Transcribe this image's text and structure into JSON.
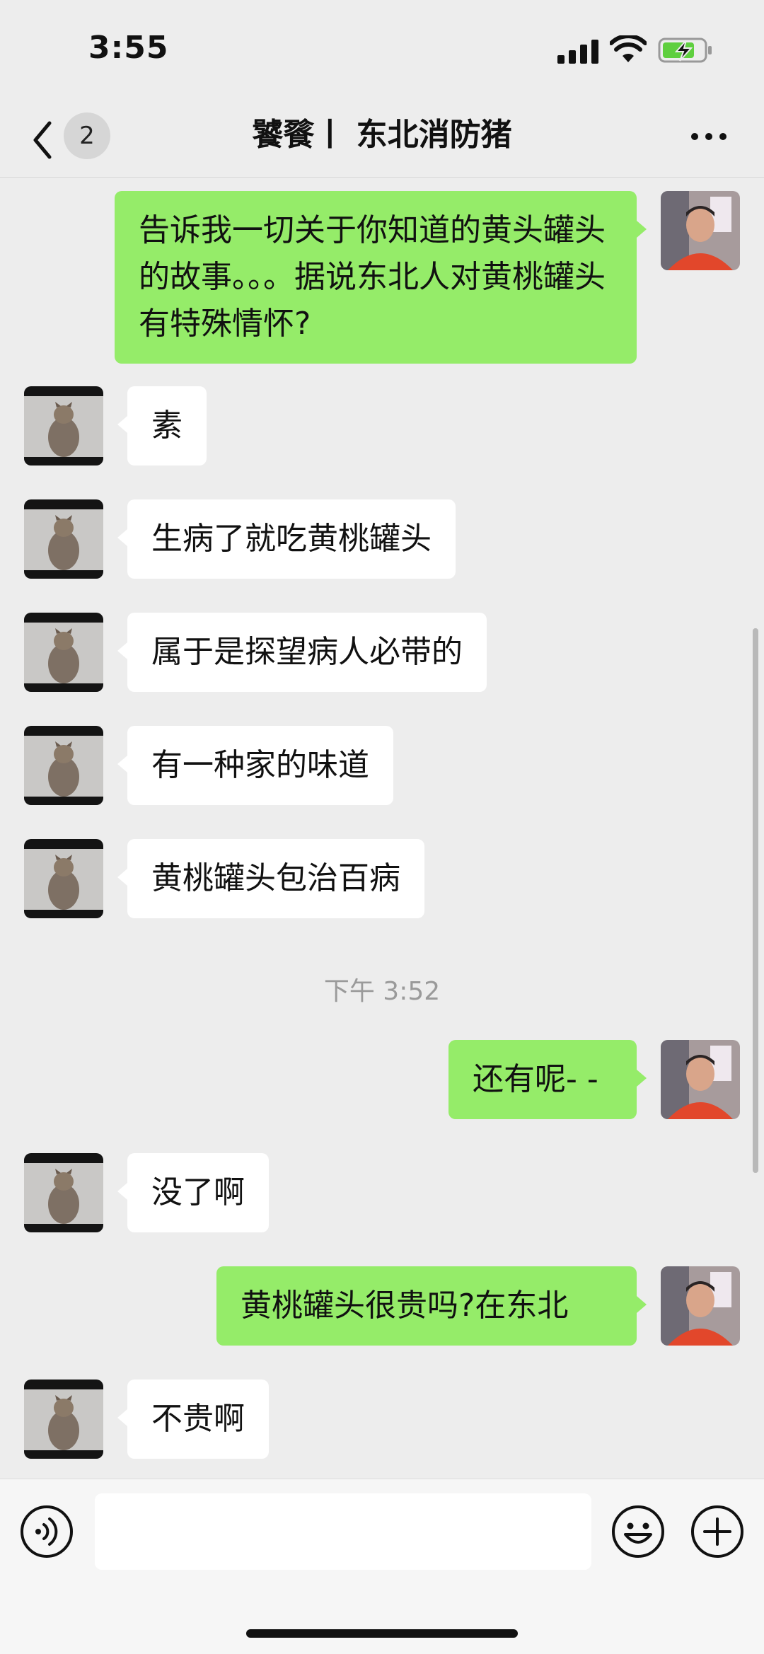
{
  "status_bar": {
    "time": "3:55"
  },
  "header": {
    "unread_count": "2",
    "title": "饕餮丨 东北消防猪"
  },
  "messages": [
    {
      "side": "out",
      "text": "告诉我一切关于你知道的黄头罐头的故事。。。据说东北人对黄桃罐头有特殊情怀?"
    },
    {
      "side": "in",
      "text": "素"
    },
    {
      "side": "in",
      "text": "生病了就吃黄桃罐头"
    },
    {
      "side": "in",
      "text": "属于是探望病人必带的"
    },
    {
      "side": "in",
      "text": "有一种家的味道"
    },
    {
      "side": "in",
      "text": "黄桃罐头包治百病"
    },
    {
      "side": "time",
      "text": "下午 3:52"
    },
    {
      "side": "out",
      "text": "还有呢- -"
    },
    {
      "side": "in",
      "text": "没了啊"
    },
    {
      "side": "out",
      "text": "黄桃罐头很贵吗?在东北"
    },
    {
      "side": "in",
      "text": "不贵啊"
    }
  ],
  "input": {
    "placeholder": "",
    "value": ""
  },
  "colors": {
    "outgoing_bubble": "#95ec69",
    "incoming_bubble": "#ffffff",
    "background": "#ededed"
  },
  "icons": {
    "back": "chevron-left-icon",
    "more": "more-dots-icon",
    "voice": "voice-icon",
    "emoji": "emoji-icon",
    "plus": "plus-icon",
    "signal": "signal-icon",
    "wifi": "wifi-icon",
    "battery": "battery-charging-icon"
  }
}
